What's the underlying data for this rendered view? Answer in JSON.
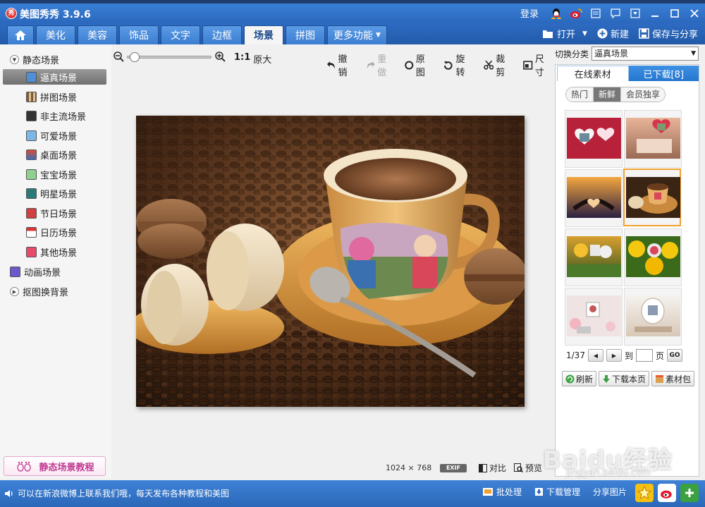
{
  "app": {
    "title": "美图秀秀 3.9.6",
    "logo_text": "秀",
    "login": "登录"
  },
  "tabs": [
    {
      "label": "美化"
    },
    {
      "label": "美容"
    },
    {
      "label": "饰品"
    },
    {
      "label": "文字"
    },
    {
      "label": "边框"
    },
    {
      "label": "场景"
    },
    {
      "label": "拼图"
    },
    {
      "label": "更多功能"
    }
  ],
  "tab_actions": {
    "open": "打开",
    "new": "新建",
    "save_share": "保存与分享"
  },
  "left": {
    "static_group": "静态场景",
    "items": [
      {
        "label": "逼真场景"
      },
      {
        "label": "拼图场景"
      },
      {
        "label": "非主流场景"
      },
      {
        "label": "可爱场景"
      },
      {
        "label": "桌面场景"
      },
      {
        "label": "宝宝场景"
      },
      {
        "label": "明星场景"
      },
      {
        "label": "节日场景"
      },
      {
        "label": "日历场景"
      },
      {
        "label": "其他场景"
      }
    ],
    "anim_group": "动画场景",
    "cutout_group": "抠图换背景",
    "tutorial": "静态场景教程"
  },
  "toolbar": {
    "ratio_label": "1:1",
    "original_size": "原大",
    "undo": "撤销",
    "redo": "重做",
    "original": "原图",
    "rotate": "旋转",
    "crop": "裁剪",
    "size": "尺寸",
    "zoom_level": 0.04
  },
  "canvas": {
    "width": "1024",
    "times": "×",
    "height": "768",
    "exif": "EXIF",
    "compare": "对比",
    "preview": "预览"
  },
  "right": {
    "switch_label": "切换分类",
    "category": "逼真场景",
    "tab_online": "在线素材",
    "tab_downloaded": "已下载[8]",
    "sub_hot": "热门",
    "sub_new": "新鲜",
    "sub_vip": "会员独享",
    "page_info": "1/37",
    "to": "到",
    "page": "页",
    "go": "GO",
    "refresh": "刷新",
    "download_page": "下载本页",
    "pack": "素材包"
  },
  "bottom": {
    "message": "可以在新浪微博上联系我们哦，每天发布各种教程和美图",
    "batch": "批处理",
    "download_mgr": "下载管理",
    "share": "分享图片"
  },
  "watermark": {
    "main": "Baidu经验",
    "sub": "jingyan.baidu.com"
  },
  "colors": {
    "title_blue": "#2b68bd",
    "accent_orange": "#f0a030",
    "pink": "#c03b93"
  }
}
